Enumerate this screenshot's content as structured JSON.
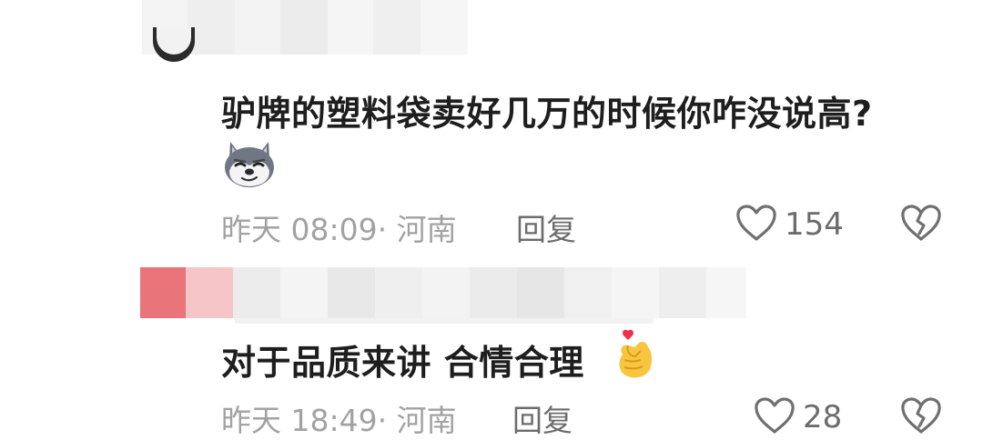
{
  "comments": [
    {
      "text": "驴牌的塑料袋卖好几万的时候你咋没说高?",
      "emoji": "dog-smirk-emoji",
      "time": "昨天 08:09",
      "separator": "·",
      "location": "河南",
      "reply_label": "回复",
      "likes": "154"
    },
    {
      "text": "对于品质来讲 合情合理",
      "emoji": "finger-heart-emoji",
      "time": "昨天 18:49",
      "separator": "·",
      "location": "河南",
      "reply_label": "回复",
      "likes": "28"
    }
  ],
  "colors": {
    "text": "#1e1e1e",
    "meta": "#a2a2a2",
    "action": "#6c6c6c",
    "icon_stroke": "#707070"
  }
}
